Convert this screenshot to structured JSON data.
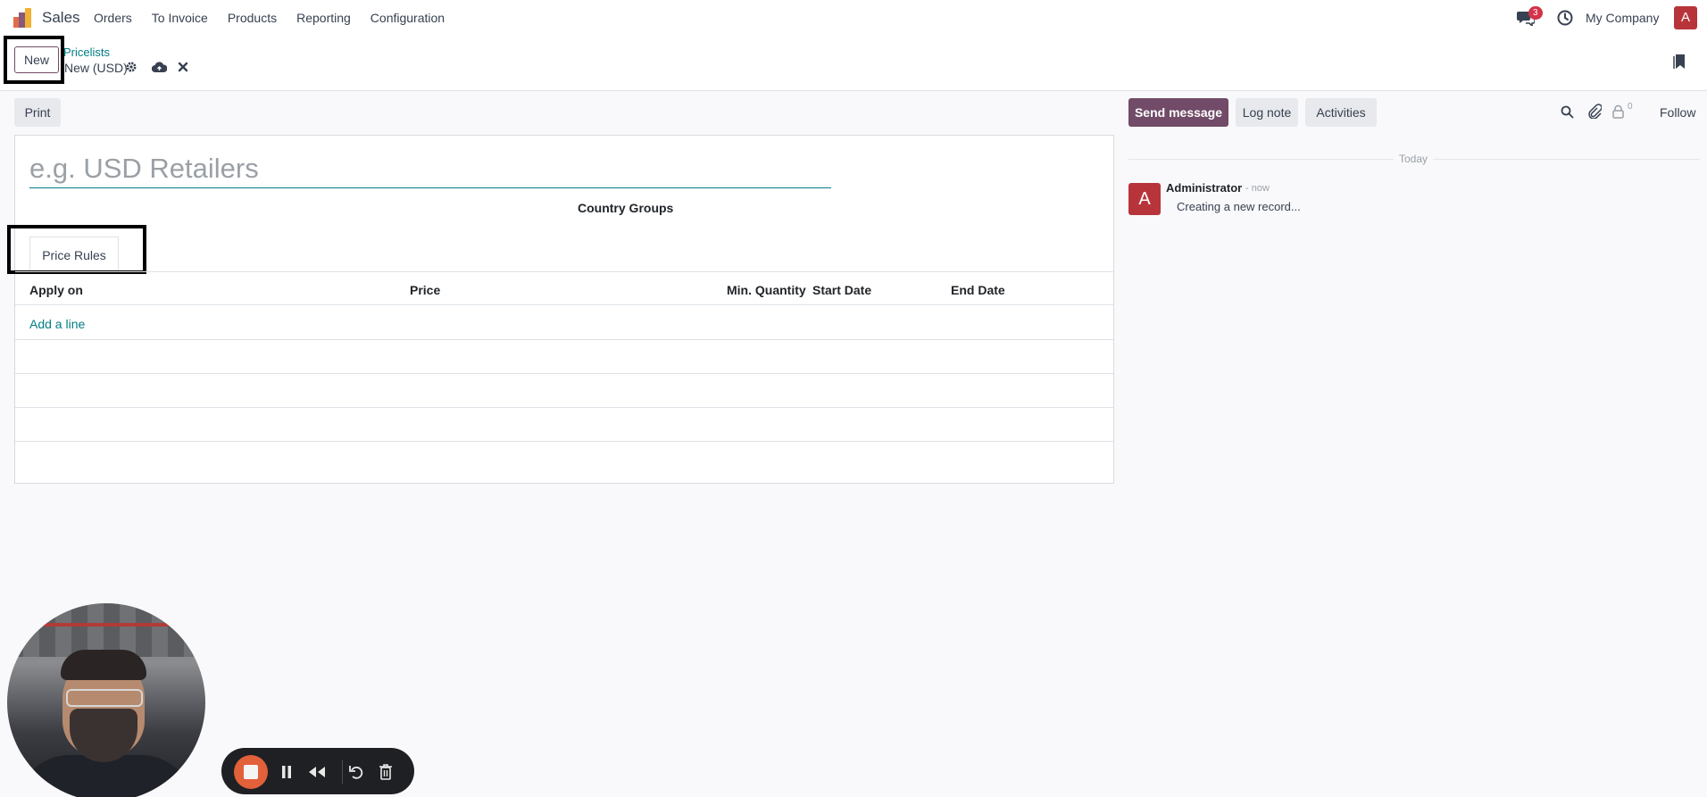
{
  "navbar": {
    "app_name": "Sales",
    "menu": [
      "Orders",
      "To Invoice",
      "Products",
      "Reporting",
      "Configuration"
    ],
    "message_count": "3",
    "company": "My Company",
    "user_initial": "A"
  },
  "control_panel": {
    "new_label": "New",
    "breadcrumb_parent": "Pricelists",
    "breadcrumb_current": "New (USD)"
  },
  "form": {
    "print_label": "Print",
    "name_placeholder": "e.g. USD Retailers",
    "country_groups_label": "Country Groups",
    "tab_label": "Price Rules",
    "columns": [
      "Apply on",
      "Price",
      "Min. Quantity",
      "Start Date",
      "End Date"
    ],
    "add_line_label": "Add a line"
  },
  "chatter": {
    "send_message_label": "Send message",
    "log_note_label": "Log note",
    "activities_label": "Activities",
    "follower_count": "0",
    "follow_label": "Follow",
    "date_separator": "Today",
    "message": {
      "avatar_initial": "A",
      "author": "Administrator",
      "time": "- now",
      "body": "Creating a new record..."
    }
  },
  "colors": {
    "brand": "#714b67",
    "link": "#017e84",
    "avatar": "#b7353a",
    "badge": "#d2344a"
  }
}
